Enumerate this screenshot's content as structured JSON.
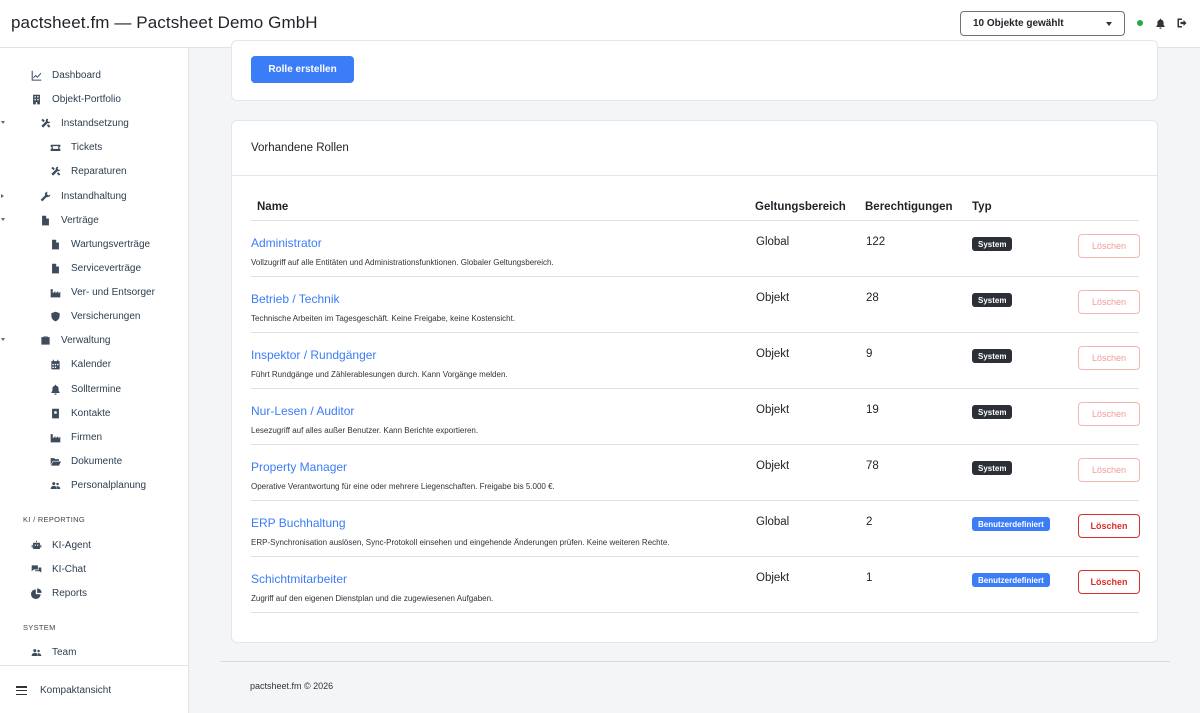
{
  "header": {
    "title": "pactsheet.fm — Pactsheet Demo GmbH",
    "object_select": "10 Objekte gewählt",
    "icons": [
      "status-dot",
      "bell-icon",
      "logout-icon"
    ],
    "status_color": "#28a745"
  },
  "sidebar": {
    "items": [
      {
        "label": "Dashboard",
        "icon": "chart-line-icon"
      },
      {
        "label": "Objekt-Portfolio",
        "icon": "building-icon"
      },
      {
        "label": "Instandsetzung",
        "icon": "tools-icon"
      },
      {
        "label": "Tickets",
        "icon": "ticket-icon"
      },
      {
        "label": "Reparaturen",
        "icon": "tools-icon"
      },
      {
        "label": "Instandhaltung",
        "icon": "wrench-icon"
      },
      {
        "label": "Verträge",
        "icon": "file-icon"
      },
      {
        "label": "Wartungsverträge",
        "icon": "file-icon"
      },
      {
        "label": "Serviceverträge",
        "icon": "file-icon"
      },
      {
        "label": "Ver- und Entsorger",
        "icon": "industry-icon"
      },
      {
        "label": "Versicherungen",
        "icon": "shield-icon"
      },
      {
        "label": "Verwaltung",
        "icon": "briefcase-icon"
      },
      {
        "label": "Kalender",
        "icon": "calendar-icon"
      },
      {
        "label": "Solltermine",
        "icon": "bell-icon"
      },
      {
        "label": "Kontakte",
        "icon": "address-book-icon"
      },
      {
        "label": "Firmen",
        "icon": "industry-icon"
      },
      {
        "label": "Dokumente",
        "icon": "folder-open-icon"
      },
      {
        "label": "Personalplanung",
        "icon": "users-icon"
      },
      {
        "label": "KI-Agent",
        "icon": "robot-icon"
      },
      {
        "label": "KI-Chat",
        "icon": "comments-icon"
      },
      {
        "label": "Reports",
        "icon": "pie-chart-icon"
      },
      {
        "label": "Team",
        "icon": "users-icon"
      }
    ],
    "sections": {
      "ki": "KI / REPORTING",
      "system": "SYSTEM"
    },
    "compact_label": "Kompaktansicht"
  },
  "create_button": "Rolle erstellen",
  "roles_card": {
    "title": "Vorhandene Rollen",
    "columns": [
      "Name",
      "Geltungsbereich",
      "Berechtigungen",
      "Typ"
    ],
    "rows": [
      {
        "name": "Administrator",
        "desc": "Vollzugriff auf alle Entitäten und Administrationsfunktionen. Globaler Geltungsbereich.",
        "scope": "Global",
        "perms": "122",
        "type": "System",
        "delete": "Löschen",
        "deletable": false
      },
      {
        "name": "Betrieb / Technik",
        "desc": "Technische Arbeiten im Tagesgeschäft. Keine Freigabe, keine Kostensicht.",
        "scope": "Objekt",
        "perms": "28",
        "type": "System",
        "delete": "Löschen",
        "deletable": false
      },
      {
        "name": "Inspektor / Rundgänger",
        "desc": "Führt Rundgänge und Zählerablesungen durch. Kann Vorgänge melden.",
        "scope": "Objekt",
        "perms": "9",
        "type": "System",
        "delete": "Löschen",
        "deletable": false
      },
      {
        "name": "Nur-Lesen / Auditor",
        "desc": "Lesezugriff auf alles außer Benutzer. Kann Berichte exportieren.",
        "scope": "Objekt",
        "perms": "19",
        "type": "System",
        "delete": "Löschen",
        "deletable": false
      },
      {
        "name": "Property Manager",
        "desc": "Operative Verantwortung für eine oder mehrere Liegenschaften. Freigabe bis 5.000 €.",
        "scope": "Objekt",
        "perms": "78",
        "type": "System",
        "delete": "Löschen",
        "deletable": false
      },
      {
        "name": "ERP Buchhaltung",
        "desc": "ERP-Synchronisation auslösen, Sync-Protokoll einsehen und eingehende Änderungen prüfen. Keine weiteren Rechte.",
        "scope": "Global",
        "perms": "2",
        "type": "Benutzerdefiniert",
        "delete": "Löschen",
        "deletable": true
      },
      {
        "name": "Schichtmitarbeiter",
        "desc": "Zugriff auf den eigenen Dienstplan und die zugewiesenen Aufgaben.",
        "scope": "Objekt",
        "perms": "1",
        "type": "Benutzerdefiniert",
        "delete": "Löschen",
        "deletable": true
      }
    ]
  },
  "footer": "pactsheet.fm © 2026",
  "colors": {
    "accent": "#3b7cf7",
    "danger": "#d9302c",
    "badge_system": "#2b2f36"
  }
}
